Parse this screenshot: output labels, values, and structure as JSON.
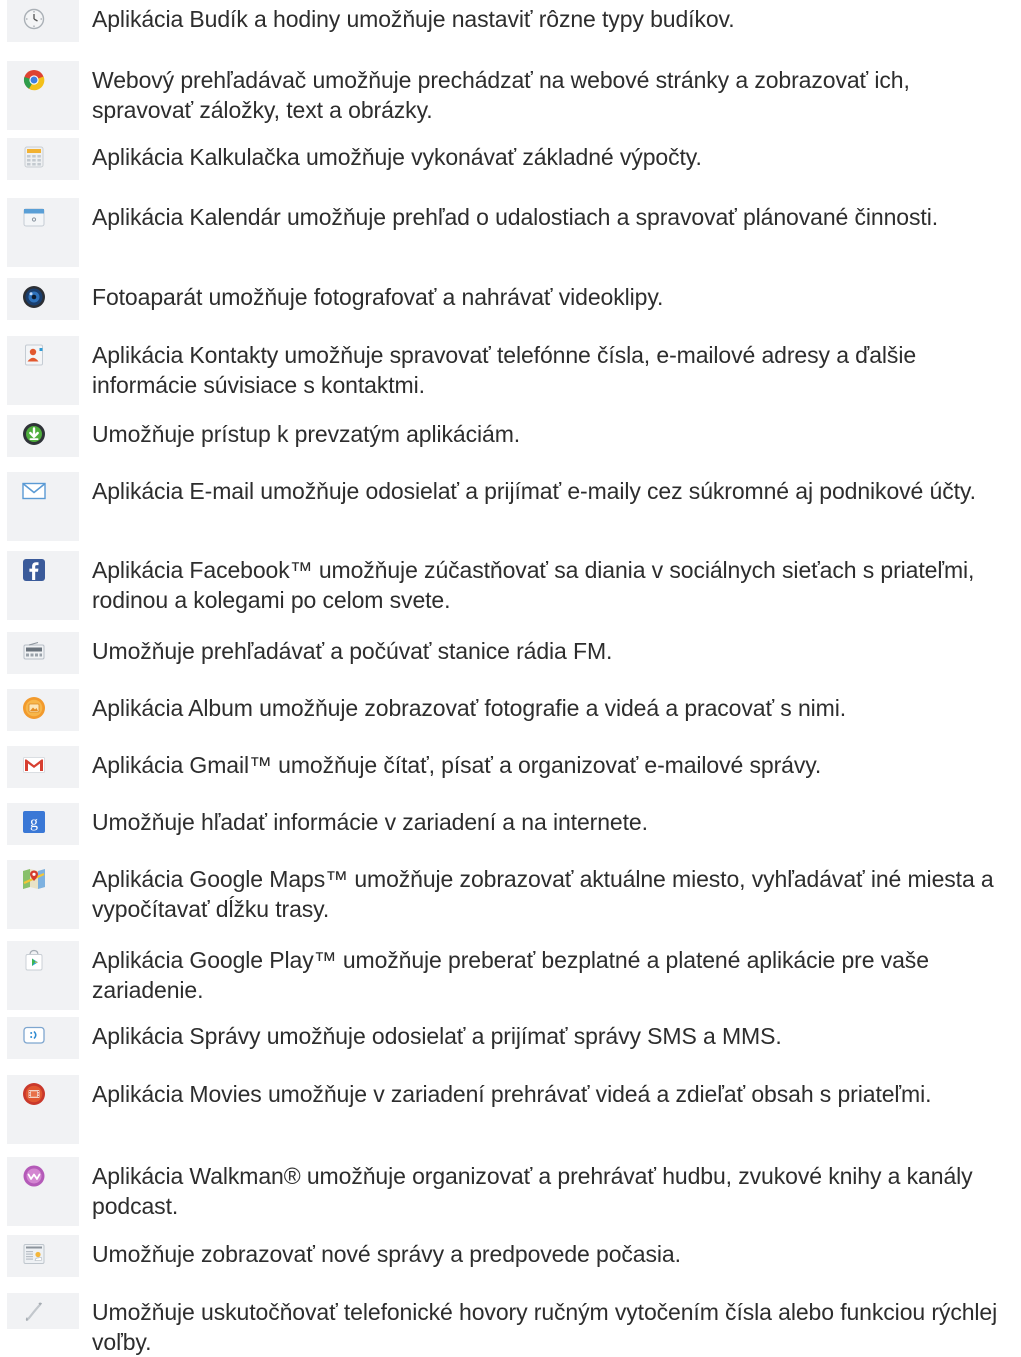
{
  "items": [
    {
      "icon": "alarm-clock-icon",
      "text": "Aplikácia Budík a hodiny umožňuje nastaviť rôzne typy budíkov."
    },
    {
      "icon": "web-browser-icon",
      "text": "Webový prehľadávač umožňuje prechádzať na webové stránky a zobrazovať ich, spravovať záložky, text a obrázky."
    },
    {
      "icon": "calculator-icon",
      "text": "Aplikácia Kalkulačka umožňuje vykonávať základné výpočty."
    },
    {
      "icon": "calendar-icon",
      "text": "Aplikácia Kalendár umožňuje prehľad o udalostiach a spravovať plánované činnosti."
    },
    {
      "icon": "camera-icon",
      "text": "Fotoaparát umožňuje fotografovať a nahrávať videoklipy."
    },
    {
      "icon": "contacts-icon",
      "text": "Aplikácia Kontakty umožňuje spravovať telefónne čísla, e-mailové adresy a ďalšie informácie súvisiace s kontaktmi."
    },
    {
      "icon": "downloads-icon",
      "text": "Umožňuje prístup k prevzatým aplikáciám."
    },
    {
      "icon": "email-icon",
      "text": "Aplikácia E-mail umožňuje odosielať a prijímať e-maily cez súkromné aj podnikové účty."
    },
    {
      "icon": "facebook-icon",
      "text": "Aplikácia Facebook™ umožňuje zúčastňovať sa diania v sociálnych sieťach s priateľmi, rodinou a kolegami po celom svete."
    },
    {
      "icon": "fm-radio-icon",
      "text": "Umožňuje prehľadávať a počúvať stanice rádia FM."
    },
    {
      "icon": "album-icon",
      "text": "Aplikácia Album umožňuje zobrazovať fotografie a videá a pracovať s nimi."
    },
    {
      "icon": "gmail-icon",
      "text": "Aplikácia Gmail™ umožňuje čítať, písať a organizovať e-mailové správy."
    },
    {
      "icon": "google-search-icon",
      "text": "Umožňuje hľadať informácie v zariadení a na internete."
    },
    {
      "icon": "google-maps-icon",
      "text": "Aplikácia Google Maps™ umožňuje zobrazovať aktuálne miesto, vyhľadávať iné miesta a vypočítavať dĺžku trasy."
    },
    {
      "icon": "google-play-icon",
      "text": "Aplikácia Google Play™ umožňuje preberať bezplatné a platené aplikácie pre vaše zariadenie."
    },
    {
      "icon": "messaging-icon",
      "text": "Aplikácia Správy umožňuje odosielať a prijímať správy SMS a MMS."
    },
    {
      "icon": "movies-icon",
      "text": "Aplikácia Movies umožňuje v zariadení prehrávať videá a zdieľať obsah s priateľmi."
    },
    {
      "icon": "walkman-icon",
      "text": "Aplikácia Walkman® umožňuje organizovať a prehrávať hudbu, zvukové knihy a kanály podcast."
    },
    {
      "icon": "news-weather-icon",
      "text": "Umožňuje zobrazovať nové správy a predpovede počasia."
    },
    {
      "icon": "phone-icon",
      "text": "Umožňuje uskutočňovať telefonické hovory ručným vytočením čísla alebo funkciou rýchlej voľby."
    }
  ]
}
